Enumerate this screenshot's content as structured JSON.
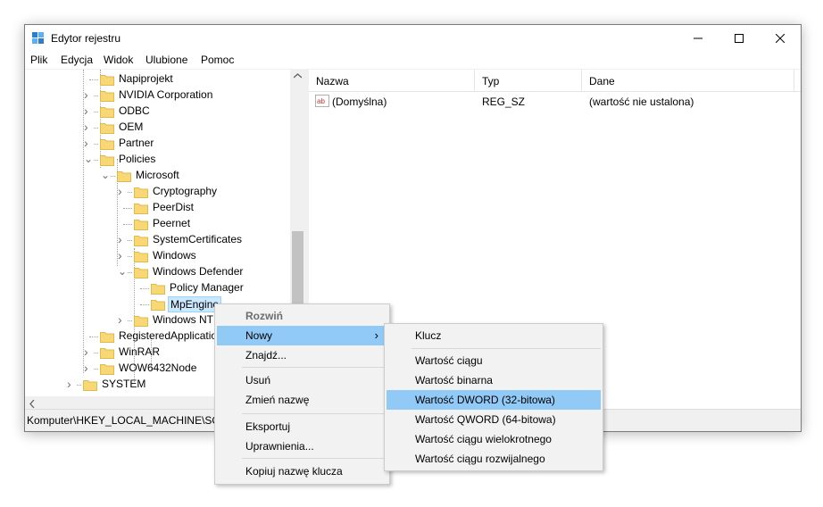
{
  "window": {
    "title": "Edytor rejestru",
    "minimize_glyph": "—",
    "maximize_glyph": "☐",
    "close_glyph": "✕"
  },
  "menubar": [
    "Plik",
    "Edycja",
    "Widok",
    "Ulubione",
    "Pomoc"
  ],
  "tree": {
    "items": [
      {
        "label": "Napiprojekt",
        "expander": "",
        "depth": 0
      },
      {
        "label": "NVIDIA Corporation",
        "expander": "›",
        "depth": 0
      },
      {
        "label": "ODBC",
        "expander": "›",
        "depth": 0
      },
      {
        "label": "OEM",
        "expander": "›",
        "depth": 0
      },
      {
        "label": "Partner",
        "expander": "›",
        "depth": 0
      },
      {
        "label": "Policies",
        "expander": "⌄",
        "depth": 0
      },
      {
        "label": "Microsoft",
        "expander": "⌄",
        "depth": 1
      },
      {
        "label": "Cryptography",
        "expander": "›",
        "depth": 2
      },
      {
        "label": "PeerDist",
        "expander": "",
        "depth": 2
      },
      {
        "label": "Peernet",
        "expander": "",
        "depth": 2
      },
      {
        "label": "SystemCertificates",
        "expander": "›",
        "depth": 2
      },
      {
        "label": "Windows",
        "expander": "›",
        "depth": 2
      },
      {
        "label": "Windows Defender",
        "expander": "⌄",
        "depth": 2
      },
      {
        "label": "Policy Manager",
        "expander": "",
        "depth": 3
      },
      {
        "label": "MpEngine",
        "expander": "",
        "depth": 3,
        "selected": true
      },
      {
        "label": "Windows NT",
        "expander": "›",
        "depth": 2
      },
      {
        "label": "RegisteredApplications",
        "expander": "",
        "depth": 0
      },
      {
        "label": "WinRAR",
        "expander": "›",
        "depth": 0
      },
      {
        "label": "WOW6432Node",
        "expander": "›",
        "depth": 0
      },
      {
        "label": "SYSTEM",
        "expander": "›",
        "depth": -1
      }
    ]
  },
  "listview": {
    "columns": [
      "Nazwa",
      "Typ",
      "Dane"
    ],
    "rows": [
      {
        "name": "(Domyślna)",
        "type": "REG_SZ",
        "data": "(wartość nie ustalona)",
        "icon": "string-value-icon"
      }
    ]
  },
  "statusbar": {
    "path": "Komputer\\HKEY_LOCAL_MACHINE\\SOF"
  },
  "context_menu": {
    "items": [
      {
        "label": "Rozwiń",
        "kind": "disabled"
      },
      {
        "label": "Nowy",
        "kind": "submenu",
        "highlight": true,
        "arrow": "›"
      },
      {
        "label": "Znajdź...",
        "kind": "normal"
      },
      {
        "label": "Usuń",
        "kind": "normal"
      },
      {
        "label": "Zmień nazwę",
        "kind": "normal"
      },
      {
        "label": "Eksportuj",
        "kind": "normal"
      },
      {
        "label": "Uprawnienia...",
        "kind": "normal"
      },
      {
        "label": "Kopiuj nazwę klucza",
        "kind": "normal"
      }
    ]
  },
  "submenu": {
    "items": [
      {
        "label": "Klucz"
      },
      {
        "label": "Wartość ciągu"
      },
      {
        "label": "Wartość binarna"
      },
      {
        "label": "Wartość DWORD (32-bitowa)",
        "highlight": true
      },
      {
        "label": "Wartość QWORD (64-bitowa)"
      },
      {
        "label": "Wartość ciągu wielokrotnego"
      },
      {
        "label": "Wartość ciągu rozwijalnego"
      }
    ]
  },
  "colors": {
    "folder": "#f8d775",
    "folder_edge": "#e0b94f",
    "selection": "#cce8ff",
    "menu_highlight": "#91c9f7"
  }
}
